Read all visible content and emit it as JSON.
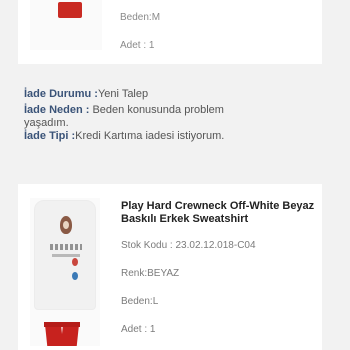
{
  "top_item": {
    "size": "Beden:M",
    "quantity": "Adet : 1"
  },
  "return_info": {
    "status_label": "İade Durumu :",
    "status_value": "Yeni Talep",
    "reason_label": "İade Neden :",
    "reason_value_line1": " Beden konusunda problem",
    "reason_value_line2": "yaşadım.",
    "type_label": "İade Tipi :",
    "type_value": "Kredi Kartıma iadesi istiyorum."
  },
  "bottom_item": {
    "title": "Play Hard Crewneck Off-White Beyaz Baskılı Erkek Sweatshirt",
    "stock_code": "Stok Kodu : 23.02.12.018-C04",
    "color": "Renk:BEYAZ",
    "size": "Beden:L",
    "quantity": "Adet : 1"
  }
}
